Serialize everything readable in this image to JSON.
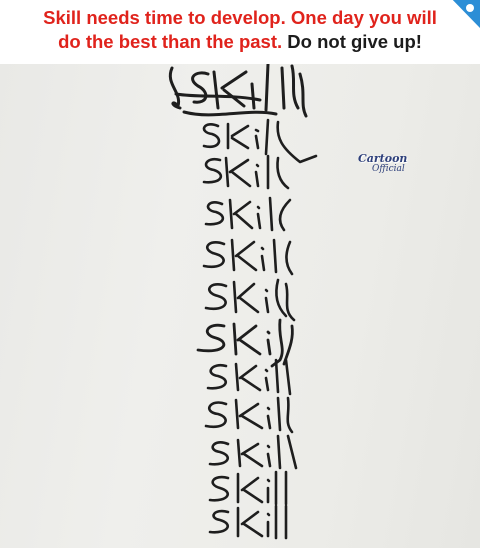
{
  "caption": {
    "line1_red": "Skill needs time to  develop. One day you will",
    "line2_red": "do the best than the past.",
    "line2_dark": "Do not give up!"
  },
  "colors": {
    "caption_red": "#e0231c",
    "caption_dark": "#1c1c1c",
    "ink": "#1e1e1e",
    "wall": "#ececea"
  },
  "watermark": {
    "top": "Cartoon",
    "bottom": "Official"
  },
  "handwriting": {
    "word": "skill",
    "attempts": 13,
    "trend": "messy at top, neat at bottom"
  }
}
